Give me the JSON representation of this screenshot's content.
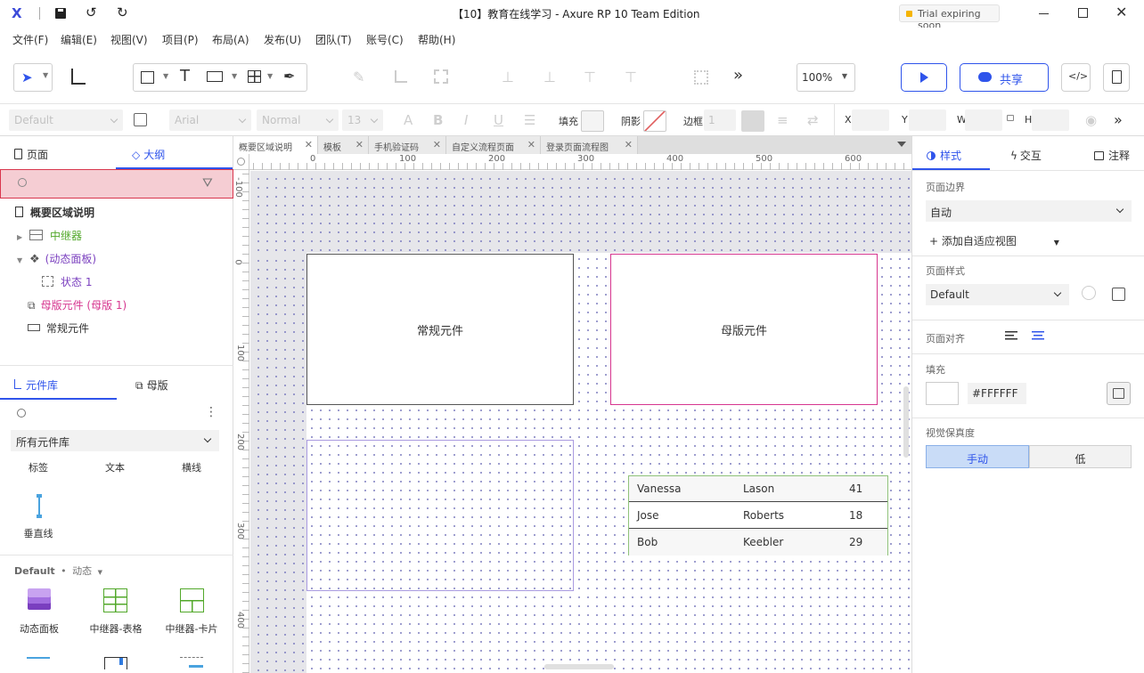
{
  "window": {
    "title": "【10】教育在线学习 - Axure RP 10 Team Edition",
    "trial_badge": "Trial expiring soon"
  },
  "menu": [
    "文件(F)",
    "编辑(E)",
    "视图(V)",
    "项目(P)",
    "布局(A)",
    "发布(U)",
    "团队(T)",
    "账号(C)",
    "帮助(H)"
  ],
  "toolbar": {
    "zoom": "100%",
    "share_label": "共享",
    "more": "»"
  },
  "format": {
    "style": "Default",
    "font": "Arial",
    "weight": "Normal",
    "size": "13",
    "fill_label": "填充",
    "shadow_label": "阴影",
    "border_label": "边框",
    "border_value": "1",
    "x_label": "X",
    "y_label": "Y",
    "w_label": "W",
    "h_label": "H"
  },
  "left": {
    "tab_pages": "页面",
    "tab_outline": "大纲",
    "outline_items": [
      {
        "label": "概要区域说明",
        "color": "#333333"
      },
      {
        "label": "中继器",
        "color": "#52a82a"
      },
      {
        "label": "(动态面板)",
        "color": "#7a3fbf"
      },
      {
        "label": "状态 1",
        "color": "#7a3fbf"
      },
      {
        "label": "母版元件 (母版 1)",
        "color": "#d6368f"
      },
      {
        "label": "常规元件",
        "color": "#333333"
      }
    ],
    "tab_library": "元件库",
    "tab_masters": "母版",
    "library_select": "所有元件库",
    "lib_row1": [
      "标签",
      "文本",
      "横线"
    ],
    "lib_vline": "垂直线",
    "default_group": "Default",
    "default_group_sub": "动态",
    "lib_row2": [
      "动态面板",
      "中继器-表格",
      "中继器-卡片"
    ]
  },
  "tabs": [
    {
      "label": "概要区域说明",
      "active": true
    },
    {
      "label": "模板",
      "active": false
    },
    {
      "label": "手机验证码",
      "active": false
    },
    {
      "label": "自定义流程页面",
      "active": false
    },
    {
      "label": "登录页面流程图",
      "active": false
    }
  ],
  "ruler": {
    "h": [
      "0",
      "100",
      "200",
      "300",
      "400",
      "500",
      "600"
    ],
    "h_neg": "-100",
    "v": [
      "0",
      "100",
      "200",
      "300",
      "400"
    ]
  },
  "canvas": {
    "widget_regular": "常规元件",
    "widget_master": "母版元件",
    "repeater_rows": [
      [
        "Vanessa",
        "Lason",
        "41"
      ],
      [
        "Jose",
        "Roberts",
        "18"
      ],
      [
        "Bob",
        "Keebler",
        "29"
      ]
    ]
  },
  "right": {
    "tab_style": "样式",
    "tab_interact": "交互",
    "tab_notes": "注释",
    "page_bounds_label": "页面边界",
    "page_bounds_value": "自动",
    "add_adaptive": "+ 添加自适应视图",
    "page_style_label": "页面样式",
    "page_style_value": "Default",
    "page_align_label": "页面对齐",
    "fill_label": "填充",
    "fill_value": "#FFFFFF",
    "fidelity_label": "视觉保真度",
    "fidelity_manual": "手动",
    "fidelity_low": "低"
  }
}
